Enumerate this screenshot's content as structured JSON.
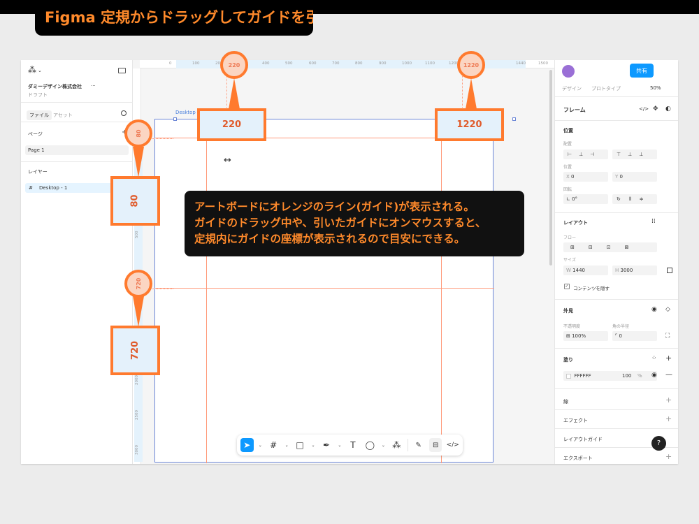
{
  "title_banner": "Figma  定規からドラッグしてガイドを引く",
  "left_panel": {
    "logo_caret": "⌄",
    "org_name": "ダミーデザイン株式会社",
    "org_more": "···",
    "draft": "ドラフト",
    "tabs": [
      "ファイル",
      "アセット"
    ],
    "pages_label": "ページ",
    "add": "+",
    "page_item": "Page 1",
    "layers_label": "レイヤー",
    "layer_item": "Desktop - 1",
    "layer_icon": "#"
  },
  "canvas": {
    "ruler_top_ticks": [
      "0",
      "100",
      "200",
      "300",
      "400",
      "500",
      "600",
      "700",
      "800",
      "900",
      "1000",
      "1100",
      "1200",
      "1300",
      "1440",
      "1500"
    ],
    "ruler_left_ticks": [
      "500",
      "1000",
      "1500",
      "2000",
      "2500",
      "3000"
    ],
    "artboard_label": "Desktop",
    "cursor": "↔",
    "guides": {
      "vertical": [
        220,
        1220
      ],
      "horizontal": [
        80,
        720
      ]
    }
  },
  "callouts": {
    "top_left": {
      "circle": "220",
      "box": "220"
    },
    "top_right": {
      "circle": "1220",
      "box": "1220"
    },
    "left_top": {
      "circle": "80",
      "box": "80"
    },
    "left_bottom": {
      "circle": "720",
      "box": "720"
    }
  },
  "tooltip_lines": [
    "アートボードにオレンジのライン(ガイド)が表示される。",
    "ガイドのドラッグ中や、引いたガイドにオンマウスすると、",
    "定規内にガイドの座標が表示されるので目安にできる。"
  ],
  "toolbar": {
    "items": [
      "move-tool",
      "frame-tool",
      "shape-tool",
      "pen-tool",
      "text-tool",
      "comment-tool",
      "actions-tool",
      "draw-mode",
      "design-mode",
      "dev-mode"
    ],
    "caret": "⌄"
  },
  "right_panel": {
    "share": "共有",
    "tabs": [
      "デザイン",
      "プロトタイプ"
    ],
    "zoom": "50%",
    "frame_label": "フレーム",
    "position": "位置",
    "align": "配置",
    "pos_label": "位置",
    "x_label": "X",
    "x": "0",
    "y_label": "Y",
    "y": "0",
    "rotation_label": "回転",
    "rotation": "0°",
    "layout": "レイアウト",
    "flow": "フロー",
    "size": "サイズ",
    "w_label": "W",
    "w": "1440",
    "h_label": "H",
    "h": "3000",
    "clip": "コンテンツを隠す",
    "appearance": "外見",
    "opacity_label": "不透明度",
    "opacity": "100%",
    "radius_label": "角の半径",
    "radius": "0",
    "fill": "塗り",
    "fill_hex": "FFFFFF",
    "fill_opacity": "100",
    "fill_pct": "%",
    "stroke": "線",
    "effects": "エフェクト",
    "layout_guide": "レイアウトガイド",
    "export": "エクスポート",
    "help": "?"
  },
  "colors": {
    "accent_orange": "#ff7a2e",
    "figma_blue": "#0d99ff",
    "guide": "#ff9a7a"
  }
}
